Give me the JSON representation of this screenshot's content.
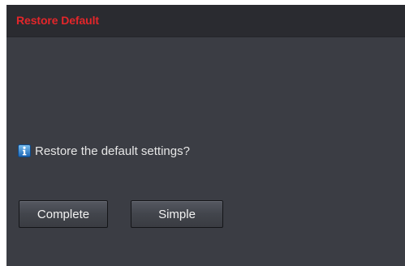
{
  "dialog": {
    "title": "Restore Default",
    "message": "Restore the default settings?",
    "message_icon": "info-icon",
    "buttons": {
      "complete_label": "Complete",
      "simple_label": "Simple"
    }
  },
  "colors": {
    "title_text": "#e3262a",
    "panel_bg": "#3b3d44",
    "titlebar_bg": "#2a2b30",
    "text": "#e6e6e6"
  }
}
